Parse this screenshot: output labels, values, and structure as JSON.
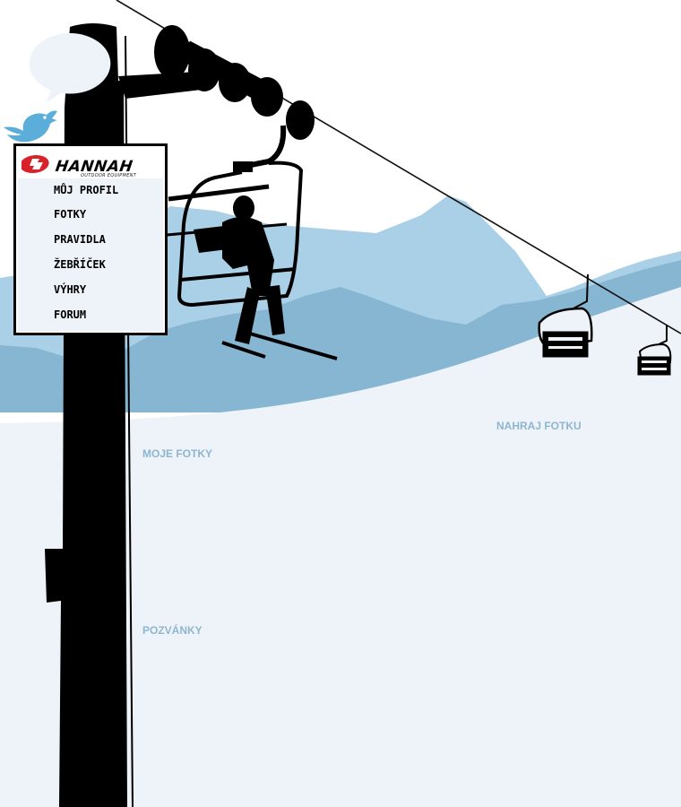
{
  "brand": {
    "name": "HANNAH",
    "tagline": "OUTDOOR EQUIPMENT"
  },
  "menu": {
    "items": [
      {
        "label": "MŮJ PROFIL"
      },
      {
        "label": "FOTKY"
      },
      {
        "label": "PRAVIDLA"
      },
      {
        "label": "ŽEBŘÍČEK"
      },
      {
        "label": "VÝHRY"
      },
      {
        "label": "FORUM"
      }
    ]
  },
  "sections": {
    "upload_photo": "NAHRAJ FOTKU",
    "my_photos": "MOJE FOTKY",
    "invitations": "POZVÁNKY"
  },
  "icons": {
    "social": "twitter-bird-icon",
    "speech": "speech-bubble-icon",
    "logo": "hannah-logo-icon"
  },
  "colors": {
    "snow": "#eef3f9",
    "mountain_far": "#a9d0e6",
    "mountain_near": "#86b6d2",
    "silhouette": "#000000",
    "link": "#8fb6cf",
    "brand_red": "#d9212a",
    "bird": "#5aaed9"
  }
}
